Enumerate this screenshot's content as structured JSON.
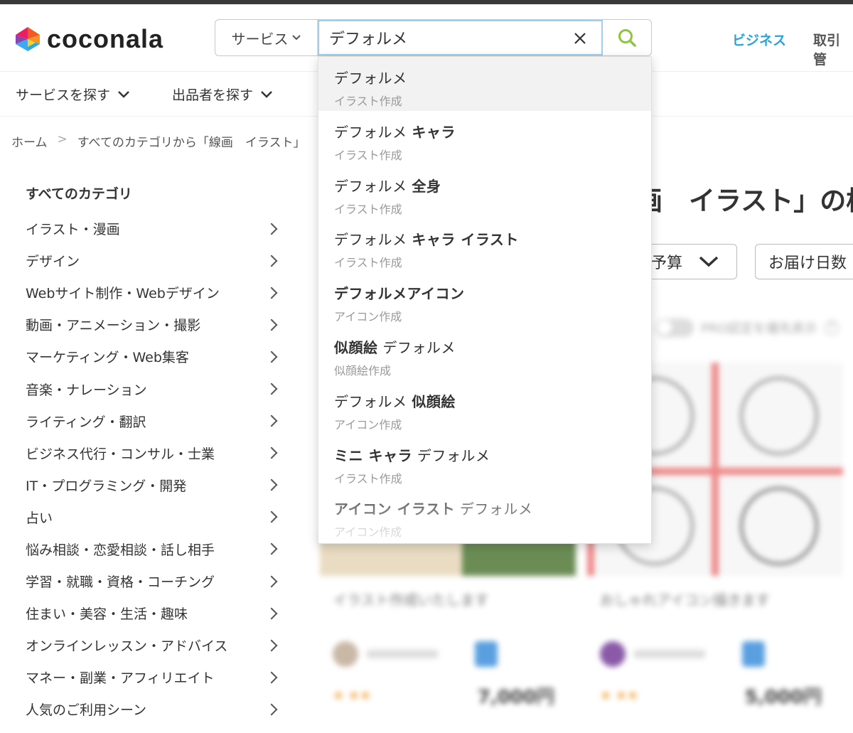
{
  "header": {
    "logo_text": "coconala",
    "service_select_label": "サービス",
    "search_value": "デフォルメ",
    "business_link": "ビジネス",
    "trade_link": "取引管"
  },
  "subnav": {
    "items": [
      "サービスを探す",
      "出品者を探す"
    ]
  },
  "breadcrumb": {
    "home": "ホーム",
    "sep": ">",
    "current": "すべてのカテゴリから「線画　イラスト」"
  },
  "sidebar": {
    "title": "すべてのカテゴリ",
    "categories": [
      "イラスト・漫画",
      "デザイン",
      "Webサイト制作・Webデザイン",
      "動画・アニメーション・撮影",
      "マーケティング・Web集客",
      "音楽・ナレーション",
      "ライティング・翻訳",
      "ビジネス代行・コンサル・士業",
      "IT・プログラミング・開発",
      "占い",
      "悩み相談・恋愛相談・話し相手",
      "学習・就職・資格・コーチング",
      "住まい・美容・生活・趣味",
      "オンラインレッスン・アドバイス",
      "マネー・副業・アフィリエイト",
      "人気のご利用シーン"
    ]
  },
  "main": {
    "title": "画　イラスト」の検",
    "budget_filter": "予算",
    "delivery_filter": "お届け日数",
    "pro_toggle_label": "PRO認定を優先表示",
    "cards": [
      {
        "title": "イラスト作成いたします",
        "price": "7,000円"
      },
      {
        "title": "おしゃれアイコン描きます",
        "price": "5,000円"
      }
    ]
  },
  "suggestions": [
    {
      "parts": [
        {
          "t": "デフォルメ",
          "b": false
        }
      ],
      "category": "イラスト作成"
    },
    {
      "parts": [
        {
          "t": "デフォルメ ",
          "b": false
        },
        {
          "t": "キャラ",
          "b": true
        }
      ],
      "category": "イラスト作成"
    },
    {
      "parts": [
        {
          "t": "デフォルメ ",
          "b": false
        },
        {
          "t": "全身",
          "b": true
        }
      ],
      "category": "イラスト作成"
    },
    {
      "parts": [
        {
          "t": "デフォルメ ",
          "b": false
        },
        {
          "t": "キャラ イラスト",
          "b": true
        }
      ],
      "category": "イラスト作成"
    },
    {
      "parts": [
        {
          "t": "デフォルメアイコン",
          "b": true
        }
      ],
      "category": "アイコン作成"
    },
    {
      "parts": [
        {
          "t": "似顔絵",
          "b": true
        },
        {
          "t": " デフォルメ",
          "b": false
        }
      ],
      "category": "似顔絵作成"
    },
    {
      "parts": [
        {
          "t": "デフォルメ ",
          "b": false
        },
        {
          "t": "似顔絵",
          "b": true
        }
      ],
      "category": "アイコン作成"
    },
    {
      "parts": [
        {
          "t": "ミニ キャラ",
          "b": true
        },
        {
          "t": " デフォルメ",
          "b": false
        }
      ],
      "category": "イラスト作成"
    },
    {
      "parts": [
        {
          "t": "アイコン イラスト",
          "b": true
        },
        {
          "t": " デフォルメ",
          "b": false
        }
      ],
      "category": "アイコン作成"
    }
  ],
  "colors": {
    "accent_blue": "#2aa3d6",
    "search_green": "#8cc63f"
  }
}
